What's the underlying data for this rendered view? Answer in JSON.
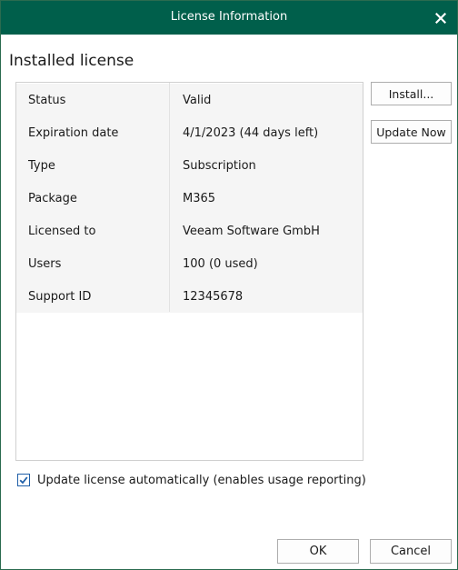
{
  "window": {
    "title": "License Information",
    "close_icon": "close-icon",
    "accent_color": "#005f4b"
  },
  "section_heading": "Installed license",
  "license": {
    "rows": [
      {
        "label": "Status",
        "value": "Valid"
      },
      {
        "label": "Expiration date",
        "value": "4/1/2023 (44 days left)"
      },
      {
        "label": "Type",
        "value": "Subscription"
      },
      {
        "label": "Package",
        "value": "M365"
      },
      {
        "label": "Licensed to",
        "value": "Veeam Software GmbH"
      },
      {
        "label": "Users",
        "value": "100 (0 used)"
      },
      {
        "label": "Support ID",
        "value": "12345678"
      }
    ]
  },
  "buttons": {
    "install_label": "Install...",
    "update_now_label": "Update Now",
    "ok_label": "OK",
    "cancel_label": "Cancel"
  },
  "auto_update": {
    "label": "Update license automatically (enables usage reporting)",
    "checked": true
  }
}
